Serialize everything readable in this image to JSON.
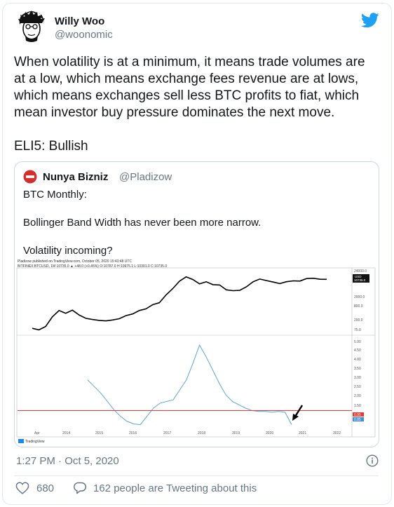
{
  "author": {
    "display_name": "Willy Woo",
    "handle": "@woonomic",
    "avatar_icon": "cartoon-avatar-icon"
  },
  "tweet": {
    "paragraphs": [
      "When volatility is at a minimum, it means trade volumes are at a low, which means exchange fees revenue are at lows, which means exchanges sell less BTC profits to fiat, which mean investor buy pressure dominates the next move.",
      "ELI5: Bullish"
    ],
    "timestamp": "1:27 PM · Oct 5, 2020",
    "like_count": "680",
    "reply_text": "162 people are Tweeting about this"
  },
  "quoted": {
    "display_name": "Nunya Bizniz",
    "handle": "@Pladizow",
    "paragraphs": [
      "BTC Monthly:",
      "Bollinger Band Width has never been more narrow.",
      "Volatility incoming?"
    ]
  },
  "chart_header": {
    "line1": "Pladizow published on TradingView.com, October 05, 2020 15:43:48 UTC",
    "line2": "BITFINEX:BTCUSD, 1M 10735.0 ▲ +48.0 (+0.45%) O:10787.0 H:10975.1 L:10391.0 C:10735.0"
  },
  "chart_data": [
    {
      "type": "line",
      "title": "",
      "x": [
        "Apr",
        "2014",
        "2015",
        "2016",
        "2017",
        "2018",
        "2019",
        "2020",
        "2021",
        "2022"
      ],
      "series": [
        {
          "values": [
            110,
            95,
            130,
            320,
            580,
            450,
            600,
            380,
            280,
            250,
            230,
            220,
            240,
            270,
            360,
            420,
            580,
            680,
            1000,
            1200,
            2500,
            4500,
            9000,
            13500,
            10500,
            7000,
            8500,
            6500,
            6300,
            4000,
            3700,
            3800,
            5300,
            8500,
            11000,
            9500,
            8300,
            7200,
            8600,
            9300,
            9100,
            11500,
            11800,
            10800,
            10700
          ]
        }
      ],
      "yaxis_labels": [
        "24000.0",
        "2000.0",
        "800.0",
        "200.0",
        "75.0"
      ],
      "price_badge": "10735.0",
      "price_badge_unit": "USD"
    },
    {
      "type": "line",
      "title": "",
      "x": [
        "Apr",
        "2014",
        "2015",
        "2016",
        "2017",
        "2018",
        "2019",
        "2020",
        "2021",
        "2022"
      ],
      "series": [
        {
          "values": [
            2.8,
            2.4,
            2.0,
            1.5,
            1.0,
            0.6,
            0.3,
            0.15,
            0.1,
            0.6,
            1.1,
            1.4,
            1.5,
            1.6,
            2.2,
            2.8,
            3.8,
            4.9,
            4.2,
            3.4,
            2.6,
            1.9,
            1.5,
            1.3,
            1.1,
            0.95,
            0.9,
            0.9,
            0.85,
            0.9,
            0.85,
            0.1
          ]
        }
      ],
      "yaxis_labels": [
        "5.00",
        "4.50",
        "4.00",
        "3.50",
        "3.00",
        "2.50",
        "2.00",
        "1.50",
        "0.95",
        "0.85"
      ],
      "reference_line": 0.95,
      "annotation": "arrow pointing to latest value"
    }
  ],
  "chart_footer": "TradingView",
  "colors": {
    "accent": "#1da1f2",
    "text_primary": "#14171a",
    "text_secondary": "#657786",
    "border": "#e1e8ed",
    "chart_line_price": "#000000",
    "chart_line_bbw": "#5aa6d8",
    "reference_line": "#e53935"
  },
  "icons": {
    "brand": "twitter-bird-icon",
    "info": "info-icon",
    "like": "heart-icon",
    "reply": "reply-bubble-icon",
    "quoted_avatar": "no-entry-icon"
  }
}
